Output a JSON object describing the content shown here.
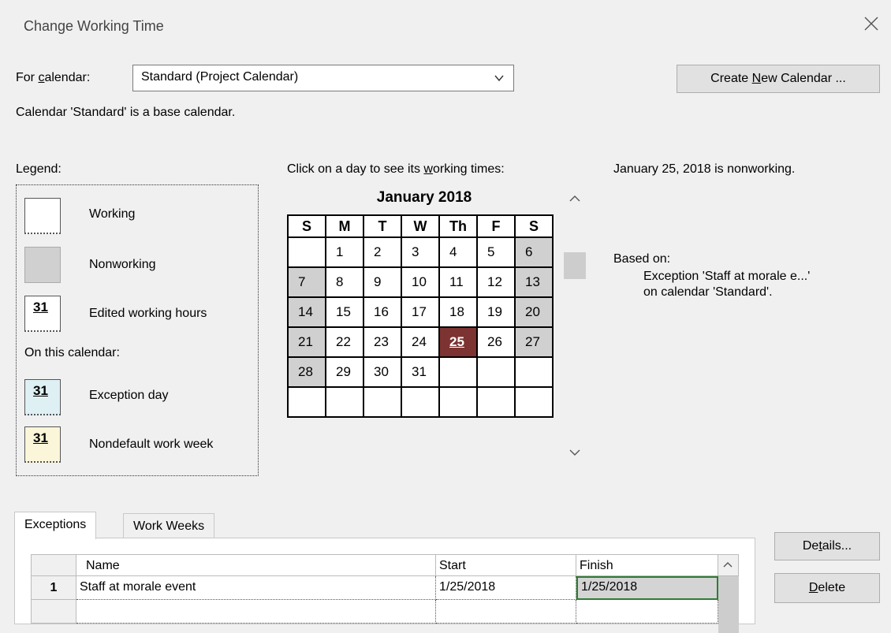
{
  "dialog": {
    "title": "Change Working Time",
    "close_glyph": "×"
  },
  "calendar_select": {
    "label_prefix": "For ",
    "label_accel": "c",
    "label_suffix": "alendar:",
    "value": "Standard (Project Calendar)",
    "base_note": "Calendar 'Standard' is a base calendar."
  },
  "create_button": {
    "prefix": "Create ",
    "accel": "N",
    "suffix": "ew Calendar ..."
  },
  "legend": {
    "heading": "Legend:",
    "working": "Working",
    "nonworking": "Nonworking",
    "edited": "Edited working hours",
    "on_this_calendar": "On this calendar:",
    "exception_day": "Exception day",
    "nondefault_week": "Nondefault work week",
    "swatch_number": "31"
  },
  "calendar": {
    "instruction_prefix": "Click on a day to see its ",
    "instruction_accel": "w",
    "instruction_suffix": "orking times:",
    "month_title": "January 2018",
    "weekdays": [
      "S",
      "M",
      "T",
      "W",
      "Th",
      "F",
      "S"
    ],
    "weeks": [
      [
        "",
        "1",
        "2",
        "3",
        "4",
        "5",
        "6"
      ],
      [
        "7",
        "8",
        "9",
        "10",
        "11",
        "12",
        "13"
      ],
      [
        "14",
        "15",
        "16",
        "17",
        "18",
        "19",
        "20"
      ],
      [
        "21",
        "22",
        "23",
        "24",
        "25",
        "26",
        "27"
      ],
      [
        "28",
        "29",
        "30",
        "31",
        "",
        "",
        ""
      ],
      [
        "",
        "",
        "",
        "",
        "",
        "",
        ""
      ]
    ],
    "selected_day": "25"
  },
  "info": {
    "status": "January 25, 2018 is nonworking.",
    "based_on_label": "Based on:",
    "based_line1": "Exception 'Staff at morale e...'",
    "based_line2": "on calendar 'Standard'."
  },
  "tabs": {
    "exceptions": "Exceptions",
    "work_weeks": "Work Weeks"
  },
  "exceptions_table": {
    "columns": {
      "name": "Name",
      "start": "Start",
      "finish": "Finish"
    },
    "rows": [
      {
        "num": "1",
        "name": "Staff at morale event",
        "start": "1/25/2018",
        "finish": "1/25/2018"
      }
    ]
  },
  "side_buttons": {
    "details_prefix": "De",
    "details_accel": "t",
    "details_suffix": "ails...",
    "delete_accel": "D",
    "delete_suffix": "elete"
  },
  "colors": {
    "selected_day": "#7c3331",
    "nonworking": "#d0d0d0",
    "active_cell_border": "#2e7d32"
  }
}
